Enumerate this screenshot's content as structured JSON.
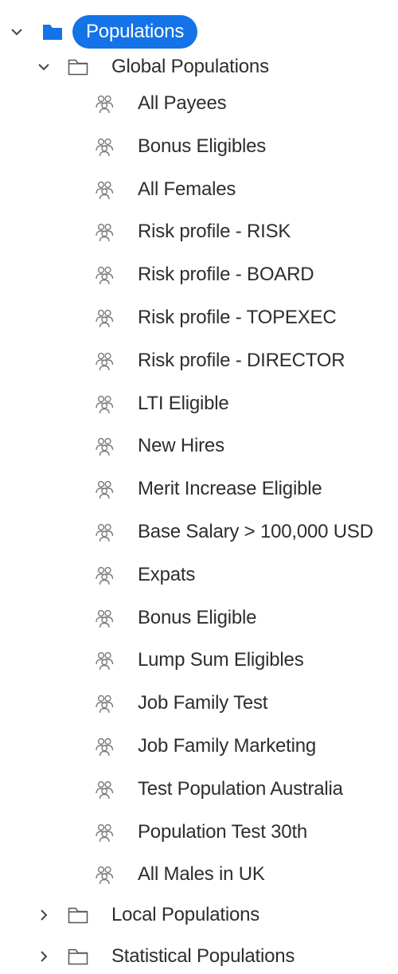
{
  "tree": {
    "root": {
      "label": "Populations",
      "expanded": true,
      "accent_color": "#1473e6",
      "icon": "folder-filled-icon"
    },
    "groups": [
      {
        "label": "Global Populations",
        "expanded": true,
        "icon": "folder-outline-icon",
        "items": [
          {
            "label": "All Payees",
            "icon": "population-icon"
          },
          {
            "label": "Bonus Eligibles",
            "icon": "population-icon"
          },
          {
            "label": "All Females",
            "icon": "population-icon"
          },
          {
            "label": "Risk profile - RISK",
            "icon": "population-icon"
          },
          {
            "label": "Risk profile - BOARD",
            "icon": "population-icon"
          },
          {
            "label": "Risk profile - TOPEXEC",
            "icon": "population-icon"
          },
          {
            "label": "Risk profile - DIRECTOR",
            "icon": "population-icon"
          },
          {
            "label": "LTI Eligible",
            "icon": "population-icon"
          },
          {
            "label": "New Hires",
            "icon": "population-icon"
          },
          {
            "label": "Merit Increase Eligible",
            "icon": "population-icon"
          },
          {
            "label": "Base Salary > 100,000 USD",
            "icon": "population-icon"
          },
          {
            "label": "Expats",
            "icon": "population-icon"
          },
          {
            "label": "Bonus Eligible",
            "icon": "population-icon"
          },
          {
            "label": "Lump Sum Eligibles",
            "icon": "population-icon"
          },
          {
            "label": "Job Family Test",
            "icon": "population-icon"
          },
          {
            "label": "Job Family Marketing",
            "icon": "population-icon"
          },
          {
            "label": "Test Population Australia",
            "icon": "population-icon"
          },
          {
            "label": "Population Test 30th",
            "icon": "population-icon"
          },
          {
            "label": "All Males in UK",
            "icon": "population-icon"
          }
        ]
      },
      {
        "label": "Local Populations",
        "expanded": false,
        "icon": "folder-outline-icon",
        "items": []
      },
      {
        "label": "Statistical Populations",
        "expanded": false,
        "icon": "folder-outline-icon",
        "items": []
      }
    ]
  }
}
